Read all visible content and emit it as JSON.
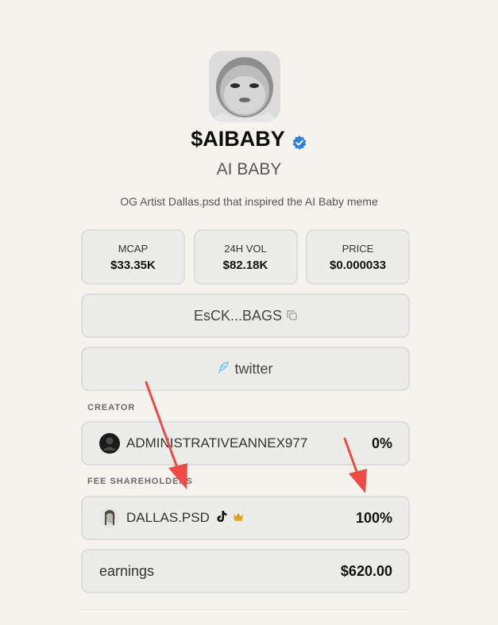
{
  "token": {
    "ticker": "$AIBABY",
    "name": "AI BABY",
    "description": "OG Artist Dallas.psd that inspired the AI Baby meme",
    "verified_icon": "verified-badge-icon"
  },
  "stats": [
    {
      "label": "MCAP",
      "value": "$33.35K"
    },
    {
      "label": "24H VOL",
      "value": "$82.18K"
    },
    {
      "label": "PRICE",
      "value": "$0.000033"
    }
  ],
  "contract": {
    "label": "EsCK...BAGS",
    "icon": "copy-icon"
  },
  "twitter": {
    "label": "twitter",
    "icon": "feather-icon"
  },
  "creator": {
    "section": "CREATOR",
    "name": "ADMINISTRATIVEANNEX977",
    "percent": "0%"
  },
  "fee_shareholders": {
    "section": "FEE SHAREHOLDERS",
    "name": "DALLAS.PSD",
    "percent": "100%",
    "icons": [
      "tiktok-icon",
      "crown-icon"
    ]
  },
  "earnings": {
    "label": "earnings",
    "value": "$620.00"
  },
  "colors": {
    "background": "#f4f3ed",
    "card": "#ececea",
    "verified": "#2f7fdd",
    "arrow": "#ef4b46",
    "crown": "#d9a21a"
  }
}
